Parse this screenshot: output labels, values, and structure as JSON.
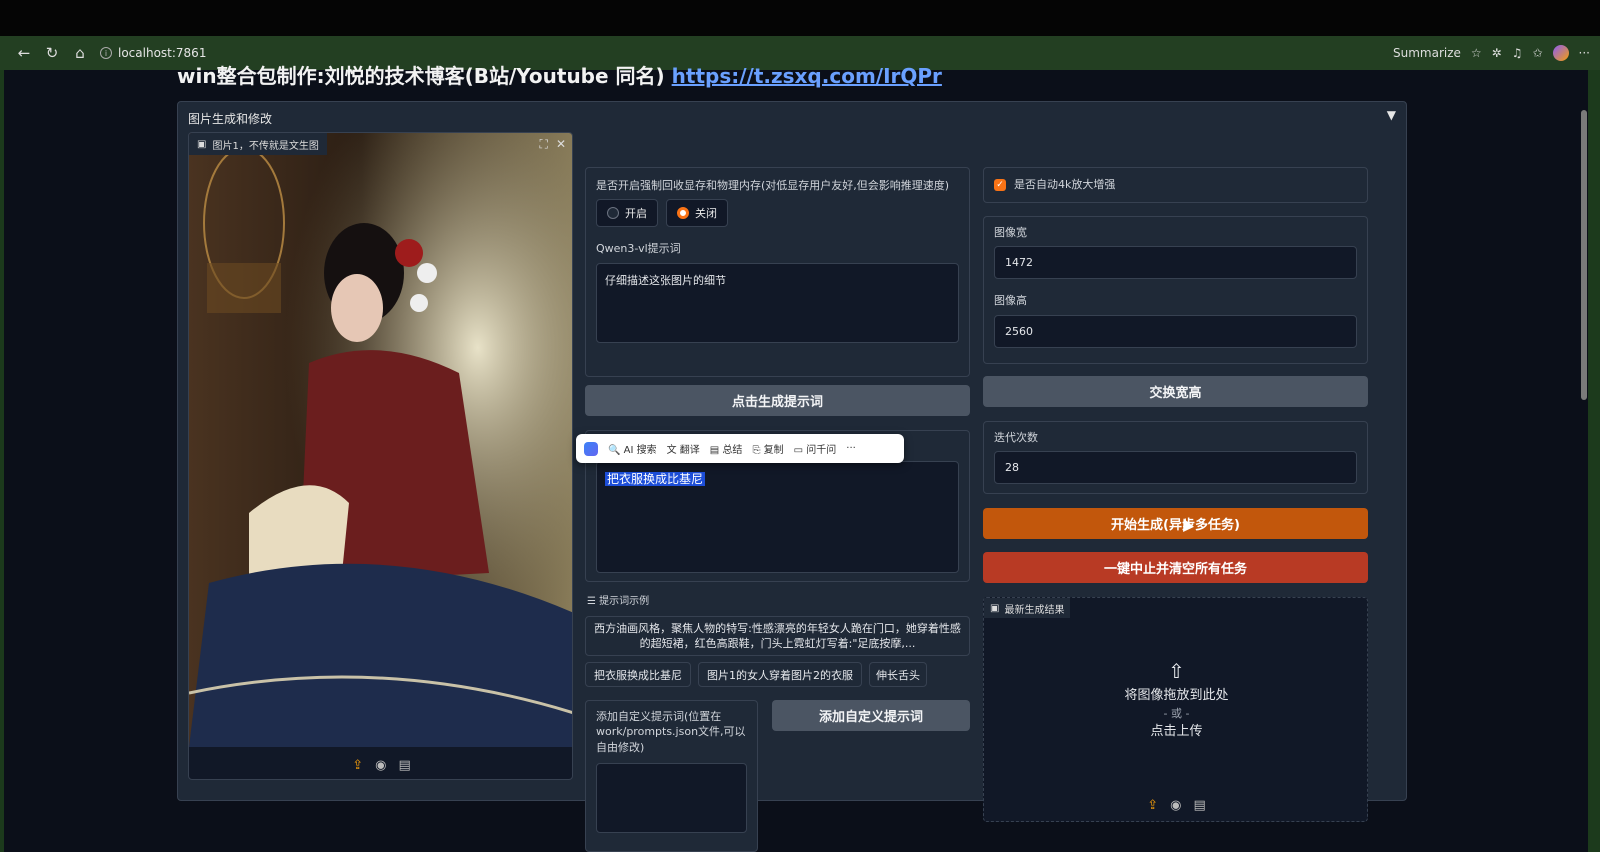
{
  "browser": {
    "url": "localhost:7861",
    "summarize_label": "Summarize"
  },
  "page": {
    "title": "win整合包制作:刘悦的技术博客(B站/Youtube 同名)",
    "link": "https://t.zsxq.com/IrQPr"
  },
  "panel": {
    "title": "图片生成和修改",
    "toggle": "▼"
  },
  "image_input": {
    "label": "图片1，不传就是文生图"
  },
  "memory": {
    "label": "是否开启强制回收显存和物理内存(对低显存用户友好,但会影响推理速度)",
    "options": [
      "开启",
      "关闭"
    ],
    "selected": "关闭"
  },
  "qwen": {
    "label": "Qwen3-vl提示词",
    "value": "仔细描述这张图片的细节"
  },
  "buttons": {
    "gen_prompt": "点击生成提示词",
    "swap": "交换宽高",
    "start": "开始生成(异步多任务)",
    "stop": "一键中止并清空所有任务",
    "add_custom": "添加自定义提示词"
  },
  "popup_toolbar": {
    "items": [
      "AI 搜索",
      "翻译",
      "总结",
      "复制",
      "问千问",
      "···"
    ]
  },
  "prompt": {
    "value": "把衣服换成比基尼"
  },
  "examples": {
    "label": "提示词示例",
    "long": "西方油画风格，聚焦人物的特写:性感漂亮的年轻女人跪在门口，她穿着性感的超短裙，红色高跟鞋，门头上霓虹灯写着:\"足底按摩,...",
    "chips": [
      "把衣服换成比基尼",
      "图片1的女人穿着图片2的衣服",
      "伸长舌头"
    ]
  },
  "custom": {
    "label": "添加自定义提示词(位置在work/prompts.json文件,可以自由修改)"
  },
  "upscale": {
    "label": "是否自动4k放大增强",
    "checked": true
  },
  "width": {
    "label": "图像宽",
    "value": "1472"
  },
  "height": {
    "label": "图像高",
    "value": "2560"
  },
  "steps": {
    "label": "迭代次数",
    "value": "28"
  },
  "result": {
    "label": "最新生成结果",
    "drop": "将图像拖放到此处",
    "or": "- 或 -",
    "click": "点击上传"
  },
  "icons": {
    "back": "arrow-left-icon",
    "reload": "reload-icon",
    "home": "home-icon",
    "info": "info-icon",
    "star": "star-icon",
    "extensions": "puzzle-icon",
    "upload": "upload-icon",
    "webcam": "webcam-icon",
    "clipboard": "clipboard-icon"
  },
  "colors": {
    "accent_orange": "#c2570c",
    "stop_red": "#b83a24",
    "panel_bg": "#1f2937",
    "page_bg": "#0b0f19",
    "link": "#6aa0ff"
  }
}
